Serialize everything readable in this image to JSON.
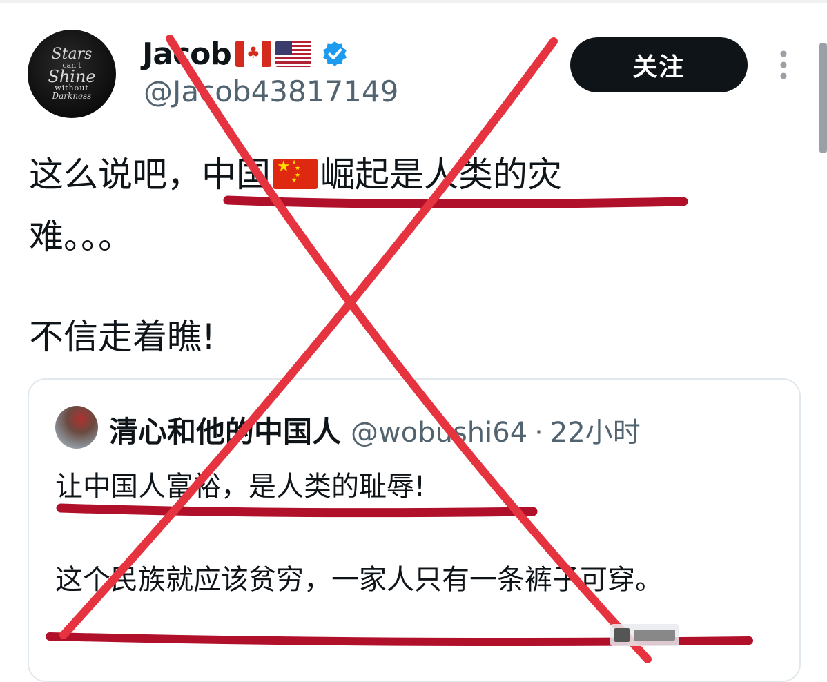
{
  "header": {
    "display_name": "Jacob",
    "name_flags": [
      "canada-flag",
      "usa-flag"
    ],
    "verified_badge": "verified-icon",
    "handle": "@Jacob43817149",
    "follow_label": "关注",
    "more_icon": "more-vertical-icon"
  },
  "avatar": {
    "text_lines": [
      "Stars",
      "can't",
      "Shine",
      "without",
      "Darkness"
    ]
  },
  "tweet": {
    "line1_before_flag": "这么说吧，中国",
    "line1_flag": "china-flag",
    "line1_after_flag": "崛起是人类的灾",
    "line2": "难。。。",
    "line3": "不信走着瞧!"
  },
  "quoted_tweet": {
    "name": "清心和他的中国人",
    "handle": "@wobushi64",
    "separator": "·",
    "time": "22小时",
    "text1": "让中国人富裕，是人类的耻辱!",
    "text2": "这个民族就应该贫穷，一家人只有一条裤子可穿。"
  },
  "annotations": {
    "cross_color": "#e5343f",
    "underline_color": "#b0102a"
  }
}
